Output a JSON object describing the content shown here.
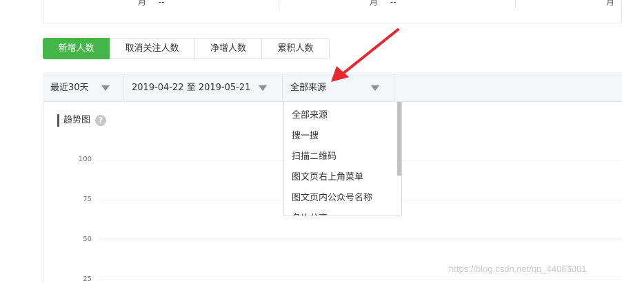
{
  "summary": {
    "cells": [
      {
        "label": "月",
        "value": "--"
      },
      {
        "label": "月",
        "value": "--"
      },
      {
        "label": "月",
        "value": ""
      }
    ]
  },
  "tabs": [
    {
      "label": "新增人数",
      "active": true
    },
    {
      "label": "取消关注人数",
      "active": false
    },
    {
      "label": "净增人数",
      "active": false
    },
    {
      "label": "累积人数",
      "active": false
    }
  ],
  "filters": {
    "range": "最近30天",
    "date_range": "2019-04-22 至 2019-05-21",
    "source": "全部来源"
  },
  "chart": {
    "title": "趋势图",
    "help_icon": "?"
  },
  "chart_data": {
    "type": "line",
    "title": "趋势图",
    "y_ticks": [
      "100",
      "75",
      "50",
      "25"
    ],
    "ylim": [
      25,
      100
    ],
    "grid": true,
    "series": []
  },
  "dropdown": {
    "options": [
      "全部来源",
      "搜一搜",
      "扫描二维码",
      "图文页右上角菜单",
      "图文页内公众号名称",
      "名片分享"
    ]
  },
  "annotation": {
    "arrow_color": "#e8282e"
  },
  "watermark": "https://blog.csdn.net/qq_44063001",
  "colors": {
    "accent": "#44b549",
    "arrow": "#e8282e"
  }
}
